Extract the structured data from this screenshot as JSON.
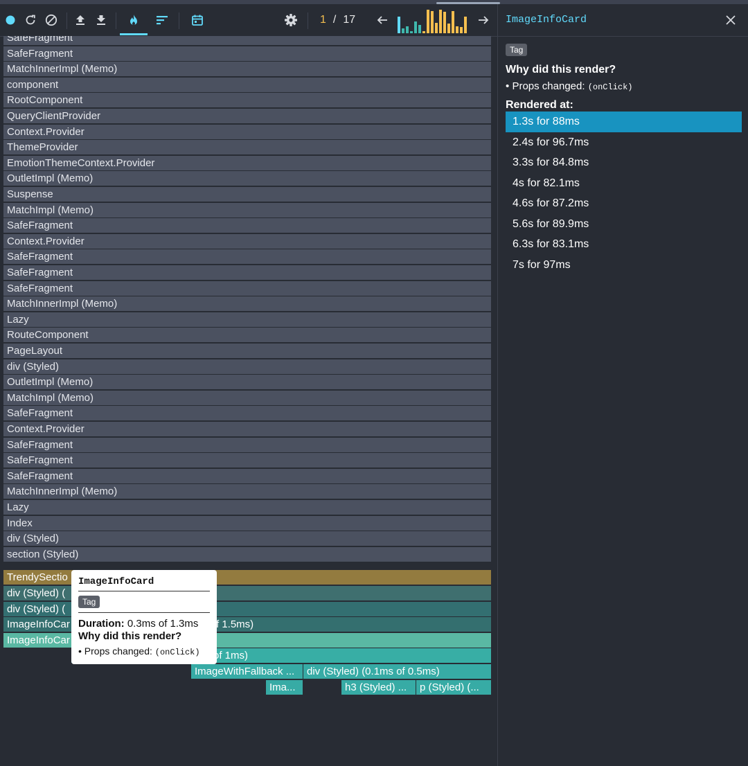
{
  "toolbar": {
    "icons": [
      "record-icon",
      "reload-icon",
      "clear-icon",
      "load-profile-icon",
      "save-profile-icon",
      "flamegraph-icon",
      "ranked-icon",
      "timeline-icon",
      "settings-icon",
      "prev-commit-icon",
      "next-commit-icon"
    ],
    "commit_current": "1",
    "commit_separator": "/",
    "commit_total": "17",
    "colors": {
      "accent": "#61dafb",
      "commit_bar": "#f5bf4f",
      "commit_selected": "#61dafb"
    },
    "commit_bars": [
      0.7,
      0.2,
      0.3,
      0.1,
      0.5,
      0.35,
      0.1,
      1.0,
      0.95,
      0.45,
      1.0,
      0.9,
      0.4,
      0.95,
      0.3,
      0.25,
      0.7
    ]
  },
  "flamegraph": {
    "rows": [
      "SafeFragment",
      "SafeFragment",
      "MatchInnerImpl (Memo)",
      "component",
      "RootComponent",
      "QueryClientProvider",
      "Context.Provider",
      "ThemeProvider",
      "EmotionThemeContext.Provider",
      "OutletImpl (Memo)",
      "Suspense",
      "MatchImpl (Memo)",
      "SafeFragment",
      "Context.Provider",
      "SafeFragment",
      "SafeFragment",
      "SafeFragment",
      "MatchInnerImpl (Memo)",
      "Lazy",
      "RouteComponent",
      "PageLayout",
      "div (Styled)",
      "OutletImpl (Memo)",
      "MatchImpl (Memo)",
      "SafeFragment",
      "Context.Provider",
      "SafeFragment",
      "SafeFragment",
      "SafeFragment",
      "MatchInnerImpl (Memo)",
      "Lazy",
      "Index",
      "div (Styled)",
      "section (Styled)"
    ],
    "rendered": [
      {
        "label": "TrendySectio",
        "color": "#937b3f"
      },
      {
        "label": "div (Styled) (",
        "color": "#3f6f6f"
      },
      {
        "label": "div (Styled) (",
        "color": "#336f71"
      },
      {
        "label": "ImageInfoCar",
        "suffix": "f 1.5ms)",
        "color": "#346f6f"
      },
      {
        "label": "ImageInfoCar",
        "color": "#5ab8a3"
      }
    ],
    "sub": {
      "row1": {
        "label": "of 1ms)",
        "color": "#38aea5"
      },
      "row2": [
        {
          "label": "ImageWithFallback ...",
          "color": "#37aba5"
        },
        {
          "label": "div (Styled) (0.1ms of 0.5ms)",
          "color": "#37aba5"
        }
      ],
      "row3": [
        {
          "label": "Ima...",
          "color": "#37aba5"
        },
        {
          "label": "h3 (Styled) ...",
          "color": "#37aba5"
        },
        {
          "label": "p (Styled) (...",
          "color": "#37aba5"
        }
      ]
    }
  },
  "tooltip": {
    "title": "ImageInfoCard",
    "badge": "Tag",
    "duration_label": "Duration:",
    "duration_value": "0.3ms of 1.3ms",
    "why": "Why did this render?",
    "bullet": "•",
    "props_label": "Props changed:",
    "props_value": "(onClick)"
  },
  "panel": {
    "title": "ImageInfoCard",
    "badge": "Tag",
    "why": "Why did this render?",
    "bullet": "•",
    "props_label": "Props changed:",
    "props_value": "(onClick)",
    "rendered_at_label": "Rendered at:",
    "renders": [
      "1.3s for 88ms",
      "2.4s for 96.7ms",
      "3.3s for 84.8ms",
      "4s for 82.1ms",
      "4.6s for 87.2ms",
      "5.6s for 89.9ms",
      "6.3s for 83.1ms",
      "7s for 97ms"
    ],
    "selected_index": 0
  }
}
